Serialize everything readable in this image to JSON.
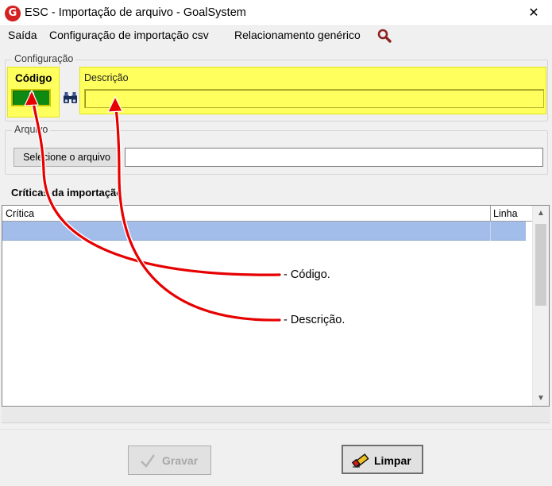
{
  "window": {
    "title": "ESC - Importação de arquivo - GoalSystem",
    "app_icon_letter": "G",
    "close_glyph": "✕"
  },
  "menu": {
    "items": [
      "Saída",
      "Configuração de importação csv",
      "Relacionamento genérico"
    ],
    "search_icon": "search-icon"
  },
  "configuracao": {
    "legend": "Configuração",
    "codigo_label": "Código",
    "codigo_value": "",
    "descricao_label": "Descrição",
    "descricao_value": "",
    "lookup_icon": "binoculars-icon"
  },
  "arquivo": {
    "legend": "Arquivo",
    "select_button": "Selecione o arquivo",
    "file_path": ""
  },
  "criticas": {
    "title": "Críticas da importação",
    "columns": [
      "Crítica",
      "Linha"
    ],
    "rows": [
      {
        "critica": "",
        "linha": ""
      }
    ]
  },
  "buttons": {
    "gravar": "Gravar",
    "limpar": "Limpar"
  },
  "annotations": [
    "- Código.",
    "- Descrição."
  ],
  "colors": {
    "highlight_yellow": "#ffff5e",
    "codigo_field": "#0e8a12",
    "selected_row": "#a2bdea",
    "arrow_red": "#e60000"
  }
}
